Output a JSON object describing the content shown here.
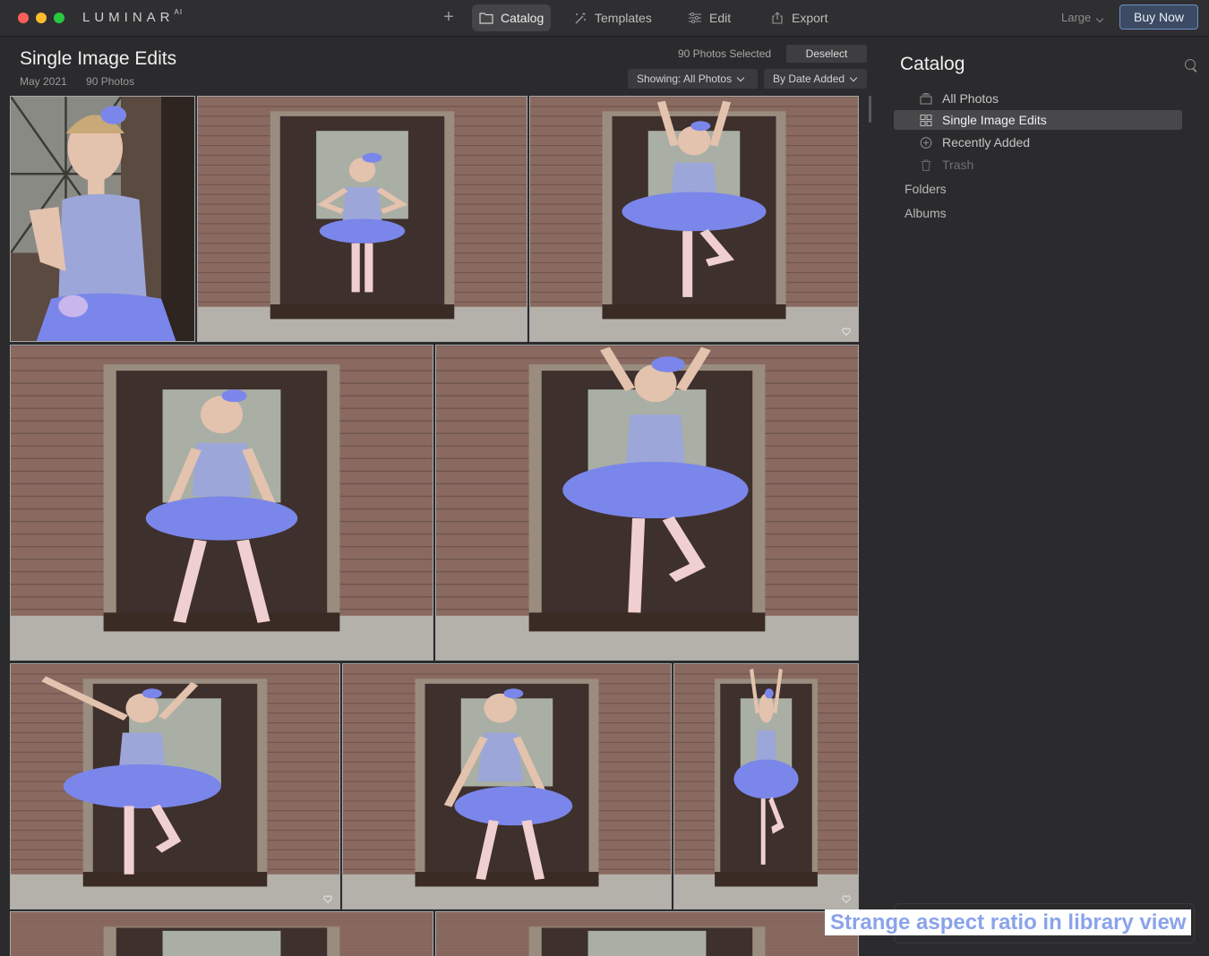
{
  "app": {
    "logo": "LUMINAR",
    "logo_sup": "AI"
  },
  "window_controls": [
    {
      "name": "close",
      "color": "#fe5f57"
    },
    {
      "name": "minimize",
      "color": "#febc2e"
    },
    {
      "name": "zoom",
      "color": "#28c840"
    }
  ],
  "nav": {
    "tabs": [
      {
        "id": "catalog",
        "label": "Catalog",
        "icon": "folder-icon",
        "active": true
      },
      {
        "id": "templates",
        "label": "Templates",
        "icon": "magic-wand-icon",
        "active": false
      },
      {
        "id": "edit",
        "label": "Edit",
        "icon": "sliders-icon",
        "active": false
      },
      {
        "id": "export",
        "label": "Export",
        "icon": "share-icon",
        "active": false
      }
    ],
    "size_select": "Large",
    "buy_now": "Buy Now"
  },
  "album": {
    "title": "Single Image Edits",
    "date": "May 2021",
    "count": "90 Photos",
    "selected_text": "90 Photos Selected",
    "deselect_label": "Deselect",
    "showing_filter": "Showing: All Photos",
    "sort": "By Date Added"
  },
  "photos": [
    {
      "pose": "close-up",
      "favorite": false
    },
    {
      "pose": "standing",
      "favorite": false
    },
    {
      "pose": "arms-up",
      "favorite": true
    },
    {
      "pose": "plie",
      "favorite": false
    },
    {
      "pose": "jump",
      "favorite": false
    },
    {
      "pose": "arm-wave",
      "favorite": true
    },
    {
      "pose": "bend",
      "favorite": false
    },
    {
      "pose": "arms-up-small",
      "favorite": true
    },
    {
      "pose": "partial",
      "favorite": false
    },
    {
      "pose": "partial-girl",
      "favorite": false
    }
  ],
  "sidebar": {
    "title": "Catalog",
    "items": [
      {
        "label": "All Photos",
        "icon": "all-photos-icon",
        "state": "normal"
      },
      {
        "label": "Single Image Edits",
        "icon": "grid-icon",
        "state": "active"
      },
      {
        "label": "Recently Added",
        "icon": "plus-circle-icon",
        "state": "normal"
      },
      {
        "label": "Trash",
        "icon": "trash-icon",
        "state": "dim"
      }
    ],
    "groups": [
      "Folders",
      "Albums"
    ]
  },
  "overlay_caption": "Strange aspect ratio in library view",
  "colors": {
    "background": "#2b2b2d",
    "accent": "#6d8fc7",
    "tutu": "#7b86ea",
    "brick": "#8a6a60",
    "door": "#3e302c"
  }
}
